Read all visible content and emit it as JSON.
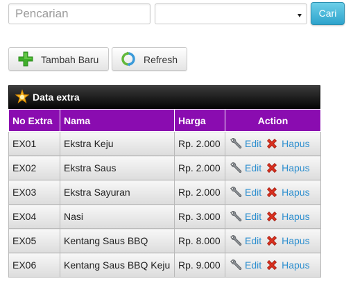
{
  "search": {
    "placeholder": "Pencarian",
    "value": ""
  },
  "filter": {
    "selected": ""
  },
  "search_button": {
    "label": "Cari"
  },
  "toolbar": {
    "add_label": "Tambah Baru",
    "refresh_label": "Refresh"
  },
  "panel": {
    "title": "Data extra"
  },
  "table": {
    "headers": [
      "No Extra",
      "Nama",
      "Harga",
      "Action"
    ],
    "edit_label": "Edit",
    "delete_label": "Hapus",
    "rows": [
      {
        "no": "EX01",
        "nama": "Ekstra Keju",
        "harga": "Rp. 2.000"
      },
      {
        "no": "EX02",
        "nama": "Ekstra Saus",
        "harga": "Rp. 2.000"
      },
      {
        "no": "EX03",
        "nama": "Ekstra Sayuran",
        "harga": "Rp. 2.000"
      },
      {
        "no": "EX04",
        "nama": "Nasi",
        "harga": "Rp. 3.000"
      },
      {
        "no": "EX05",
        "nama": "Kentang Saus BBQ",
        "harga": "Rp. 8.000"
      },
      {
        "no": "EX06",
        "nama": "Kentang Saus BBQ Keju",
        "harga": "Rp. 9.000"
      }
    ]
  },
  "icons": {
    "add": "plus-icon",
    "refresh": "refresh-icon",
    "panel": "star-badge-icon",
    "edit": "wrench-icon",
    "delete": "close-x-icon"
  },
  "colors": {
    "header_purple": "#8a0cb0",
    "link_blue": "#2e8fcf",
    "search_button": "#2ea3cc",
    "add_green": "#3fae2a",
    "delete_red": "#d9301f"
  }
}
